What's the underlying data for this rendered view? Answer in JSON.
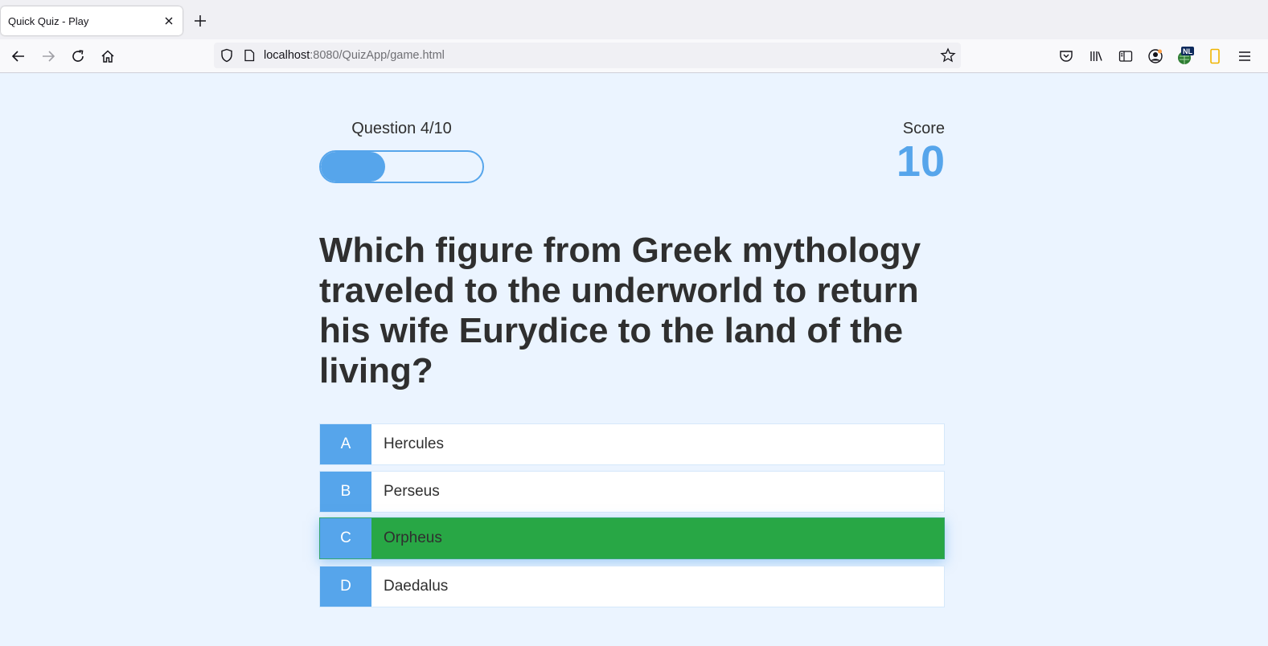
{
  "browser": {
    "tab_title": "Quick Quiz - Play",
    "url_host": "localhost",
    "url_rest": ":8080/QuizApp/game.html",
    "icons": [
      "close-icon",
      "plus-icon",
      "back-icon",
      "forward-icon",
      "reload-icon",
      "home-icon",
      "shield-icon",
      "page-icon",
      "star-icon",
      "pocket-icon",
      "library-icon",
      "sidebar-icon",
      "account-icon",
      "nl-extension-icon",
      "phone-extension-icon",
      "menu-icon"
    ]
  },
  "hud": {
    "question_label": "Question 4/10",
    "progress_fraction": 0.4,
    "score_label": "Score",
    "score_value": "10"
  },
  "question": "Which figure from Greek mythology traveled to the underworld to return his wife Eurydice to the land of the living?",
  "choices": [
    {
      "prefix": "A",
      "text": "Hercules",
      "state": "normal"
    },
    {
      "prefix": "B",
      "text": "Perseus",
      "state": "normal"
    },
    {
      "prefix": "C",
      "text": "Orpheus",
      "state": "correct"
    },
    {
      "prefix": "D",
      "text": "Daedalus",
      "state": "normal"
    }
  ],
  "colors": {
    "accent": "#56a5eb",
    "correct": "#28a745",
    "page_bg": "#ebf4ff",
    "text": "#2f2f2f"
  }
}
